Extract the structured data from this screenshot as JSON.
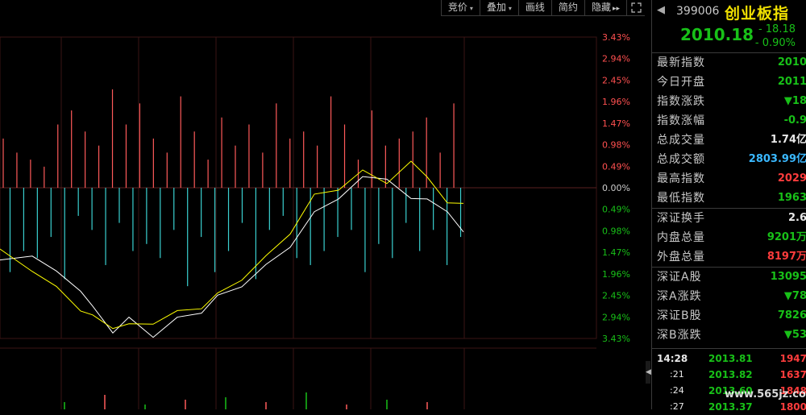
{
  "toolbar": {
    "items": [
      "竞价",
      "叠加",
      "画线",
      "简约",
      "隐藏"
    ],
    "item_carets": [
      true,
      true,
      false,
      false,
      false
    ],
    "hide_arrows": "▸▸"
  },
  "chart_data": {
    "type": "line",
    "y_axis_labels": [
      "3.43%",
      "2.94%",
      "2.45%",
      "1.96%",
      "1.47%",
      "0.98%",
      "0.49%",
      "0.00%",
      "0.49%",
      "0.98%",
      "1.47%",
      "1.96%",
      "2.45%",
      "2.94%",
      "3.43%"
    ],
    "y_axis_colors": {
      "upper": "#ff5050",
      "zero": "#cccccc",
      "lower": "#18c018"
    },
    "ylim_pct": [
      -3.43,
      3.43
    ],
    "series": [
      {
        "color": "#ffffff",
        "values": [
          -1.7,
          -1.5,
          -1.95,
          -2.3,
          -2.75,
          -3.25,
          -3.0,
          -3.35,
          -3.0,
          -2.8,
          -2.5,
          -2.2,
          -1.8,
          -1.3,
          -0.6,
          -0.2,
          0.2,
          0.25,
          -0.3,
          -0.2,
          -0.6,
          -0.95
        ]
      },
      {
        "color": "#ffff00",
        "values": [
          -1.45,
          -1.85,
          -2.3,
          -2.75,
          -2.95,
          -3.15,
          -3.15,
          -3.05,
          -2.85,
          -2.7,
          -2.45,
          -2.05,
          -1.6,
          -1.0,
          -0.2,
          0.0,
          0.35,
          0.15,
          0.55,
          0.3,
          -0.4,
          -0.3
        ]
      }
    ],
    "x": [
      0,
      40,
      70,
      100,
      115,
      140,
      160,
      190,
      220,
      250,
      270,
      300,
      330,
      360,
      390,
      420,
      450,
      480,
      510,
      530,
      555,
      575
    ],
    "volume_bars": [
      0.7,
      -1.2,
      0.5,
      -0.9,
      0.4,
      -1.0,
      0.3,
      -0.7,
      0.9,
      -1.3,
      1.1,
      -0.4,
      0.8,
      -0.6,
      0.6,
      -1.1,
      1.4,
      -0.5,
      0.9,
      -0.9,
      1.2,
      -0.8,
      0.7,
      -1.0,
      0.5,
      -0.6,
      1.3,
      -1.4,
      0.8,
      -0.7,
      0.4,
      -1.2,
      1.0,
      -0.9,
      0.6,
      -0.5,
      0.9,
      -1.3,
      0.5,
      -0.6,
      1.2,
      -0.4,
      0.7,
      -1.0,
      0.8,
      -1.1,
      0.6,
      -0.9,
      1.3,
      -0.7,
      0.9,
      -0.6,
      0.4,
      -1.2,
      1.1,
      -0.8,
      0.6,
      -1.0,
      0.7,
      -0.5,
      0.8,
      -0.9,
      1.0,
      -0.6,
      0.5,
      -1.1,
      1.2,
      -0.7
    ],
    "lower_volume": [
      0.3,
      0.6,
      0.2,
      0.4,
      0.5,
      0.3,
      0.7,
      0.2,
      0.4,
      0.3
    ]
  },
  "index": {
    "code": "399006",
    "name": "创业板指",
    "price": "2010.18",
    "change": "- 18.18",
    "change_pct": "- 0.90%"
  },
  "stats": [
    {
      "label": "最新指数",
      "value": "2010",
      "color": "green"
    },
    {
      "label": "今日开盘",
      "value": "2011",
      "color": "green"
    },
    {
      "label": "指数涨跌",
      "value": "▼18",
      "color": "green"
    },
    {
      "label": "指数涨幅",
      "value": "-0.9",
      "color": "green"
    },
    {
      "label": "总成交量",
      "value": "1.74亿",
      "color": "white"
    },
    {
      "label": "总成交额",
      "value": "2803.99亿",
      "color": "cyan"
    },
    {
      "label": "最高指数",
      "value": "2029",
      "color": "red"
    },
    {
      "label": "最低指数",
      "value": "1963",
      "color": "green"
    }
  ],
  "stats2": [
    {
      "label": "深证换手",
      "value": "2.6",
      "color": "white"
    },
    {
      "label": "内盘总量",
      "value": "9201万",
      "color": "green"
    },
    {
      "label": "外盘总量",
      "value": "8197万",
      "color": "red"
    }
  ],
  "stats3": [
    {
      "label": "深证A股",
      "value": "13095",
      "color": "green"
    },
    {
      "label": "深A涨跌",
      "value": "▼78",
      "color": "green"
    },
    {
      "label": "深证B股",
      "value": "7826",
      "color": "green"
    },
    {
      "label": "深B涨跌",
      "value": "▼53",
      "color": "green"
    }
  ],
  "ticks": [
    {
      "time": "14:28",
      "price": "2013.81",
      "vol": "1947"
    },
    {
      "time": ":21",
      "price": "2013.82",
      "vol": "1637"
    },
    {
      "time": ":24",
      "price": "2013.60",
      "vol": "1848"
    },
    {
      "time": ":27",
      "price": "2013.37",
      "vol": "1800"
    }
  ],
  "watermark": "www.565jz.com"
}
